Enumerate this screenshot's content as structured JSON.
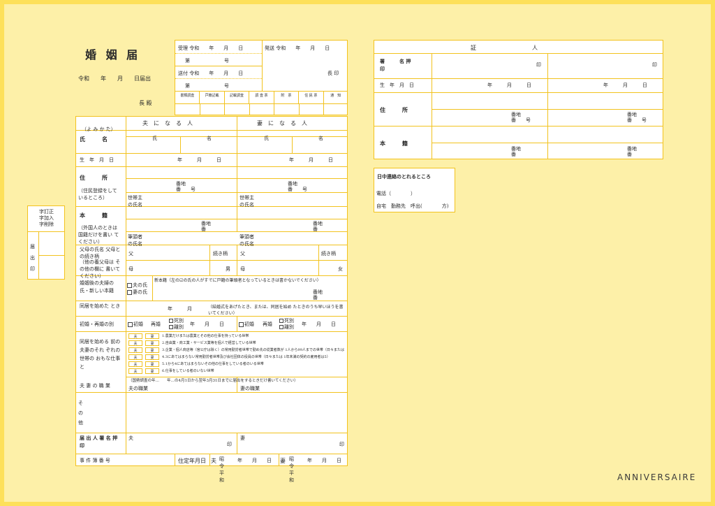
{
  "header": {
    "title": "婚 姻 届",
    "date_line": "令和　　年　　月　　日届出",
    "addressee": "長 殿"
  },
  "office": {
    "received": "受理 令和　　年　　月　　日",
    "received_no": "第　　　　　　　号",
    "sent": "送付 令和　　年　　月　　日",
    "sent_no": "第　　　　　　　号",
    "dispatch": "発送 令和　　年　　月　　日",
    "chief_seal": "長 印",
    "checks": [
      "書類調査",
      "戸籍記載",
      "記載調査",
      "調 査 票",
      "附　票",
      "住 民 票",
      "通　知"
    ]
  },
  "side_stamp": {
    "corrections": [
      "字訂正",
      "字加入",
      "字削除"
    ],
    "seal": "届 出 印"
  },
  "columns": {
    "husband": "夫　に　な　る　人",
    "wife": "妻　に　な　る　人",
    "reading": "（よ み か た）"
  },
  "rows": {
    "name": "氏　　　名",
    "surname": "氏",
    "given": "名",
    "birth": "生　年　月　日",
    "ymd": "年　　　月　　　日",
    "address": "住　　　所",
    "address_note": "（住民登録をして いるところ）",
    "banchi": "番地",
    "ban": "番　　号",
    "householder": "世帯主 の氏名",
    "honseki": "本　　　籍",
    "honseki_note": "（外国人のときは 国籍だけを書い てください）",
    "banchi2": "番地",
    "ban2": "番",
    "head": "筆頭者 の氏名",
    "parents": "父母の氏名 父母との続き柄",
    "parents_note": "（他の養父母は その他の欄に 書いてください）",
    "father": "父",
    "mother": "母",
    "relation": "続き柄",
    "son": "男",
    "daughter": "女",
    "new_honseki_label": "婚姻後の夫婦の 氏・新しい本籍",
    "husband_surname": "夫の氏",
    "wife_surname": "妻の氏",
    "new_honseki": "新本籍（左の☑の氏の人がすでに戸籍の筆頭者となっているときは書かないでください）",
    "cohab": "同居を始めた とき",
    "cohab_ym": "年　　　月",
    "cohab_note": "（結婚式をあげたとき、または、同居を始め たときのうち早いほうを書いてください）",
    "marriage_count": "初婚・再婚の別",
    "first": "初婚",
    "re": "再婚",
    "bereaved": "死別",
    "divorced": "離別",
    "ymd_short": "年　　月　　日",
    "work_label": "同居を始める 前の夫妻のそれ ぞれの世帯の おもな仕事と",
    "occupation_label": "夫 妻 の 職 業",
    "census_note": "（国勢調査の年…　　年…の4月1日から翌年3月31日までに届出をするときだけ書いてください）",
    "husband_job": "夫の職業",
    "wife_job": "妻の職業",
    "other": "そ の 他",
    "signer": "届 出 人 署 名 押 印",
    "hus": "夫",
    "wif": "妻",
    "seal": "印",
    "case_no": "事 件 簿 番 号",
    "birth_fixed": "住定年月日",
    "reiwa": "昭令 平和",
    "ymd_end": "年　　月　　日"
  },
  "work_items": [
    {
      "h": "夫",
      "w": "妻",
      "text": "1.農業だけまたは農業とその他の仕事を持っている世帯"
    },
    {
      "h": "夫",
      "w": "妻",
      "text": "2.自由業・商工業・サービス業等を個人で経営している世帯"
    },
    {
      "h": "夫",
      "w": "妻",
      "text": "3.企業・個人商店等（官公庁は除く）の常用勤労者世帯で勤め先の従業者数が 1人から99人までの世帯（日々または1年未満の契約の雇用者は5）"
    },
    {
      "h": "夫",
      "w": "妻",
      "text": "4.3にあてはまらない常用勤労者世帯及び会社団体の役員の世帯（日々または 1年未満の契約の雇用者は5）"
    },
    {
      "h": "夫",
      "w": "妻",
      "text": "5.1から4にあてはまらないその他の仕事をしている者のいる世帯"
    },
    {
      "h": "夫",
      "w": "妻",
      "text": "6.仕事をしている者のいない世帯"
    }
  ],
  "witness": {
    "title": "証　　　　　　　　　　人",
    "sign": "署　　　名 押　　　印",
    "seal": "印",
    "birth": "生　年　月　日",
    "ymd": "年　　　月　　　日",
    "address": "住　　　所",
    "banchi": "番地",
    "ban": "番　　号",
    "honseki": "本　　　籍",
    "banchi2": "番地",
    "ban2": "番"
  },
  "contact": {
    "title": "日中連絡のとれるところ",
    "phone": "電話（　　　　）",
    "place": "自宅　勤務先　呼出(　　　　方)"
  },
  "brand": "ANNIVERSAIRE",
  "colors": {
    "background": "#fdf0a8",
    "border": "#fde05a",
    "rule": "#f2c21d"
  }
}
